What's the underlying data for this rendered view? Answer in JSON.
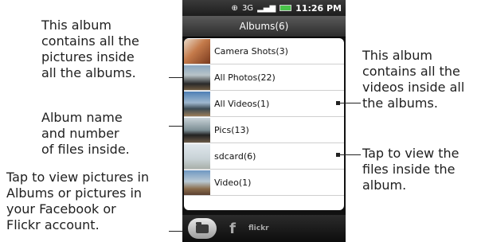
{
  "phone": {
    "status_time": "11:26 PM",
    "status_icons": [
      "headset-icon",
      "3g-icon",
      "signal-icon",
      "battery-icon"
    ],
    "title": "Albums(6)",
    "albums": [
      {
        "label": "Camera Shots(3)",
        "thumb": "camera-shots-thumbnail"
      },
      {
        "label": "All Photos(22)",
        "thumb": "all-photos-thumbnail"
      },
      {
        "label": "All Videos(1)",
        "thumb": "all-videos-thumbnail"
      },
      {
        "label": "Pics(13)",
        "thumb": "pics-thumbnail"
      },
      {
        "label": "sdcard(6)",
        "thumb": "sdcard-thumbnail"
      },
      {
        "label": "Video(1)",
        "thumb": "video-thumbnail"
      }
    ],
    "tabs": {
      "albums_icon": "folder-icon",
      "facebook": "f",
      "flickr": "flickr"
    }
  },
  "callouts": {
    "all_albums": "This album contains all the pictures inside all the albums.",
    "album_name": "Album name and number of files inside.",
    "tap_view_pictures": "Tap to view pictures in Albums or pictures in your Facebook or Flickr account.",
    "all_videos": "This album contains all the videos inside all the albums.",
    "tap_view_files": "Tap to view the files inside the album."
  },
  "colors": {
    "battery": "#49c34a",
    "phone_bg": "#111111"
  }
}
